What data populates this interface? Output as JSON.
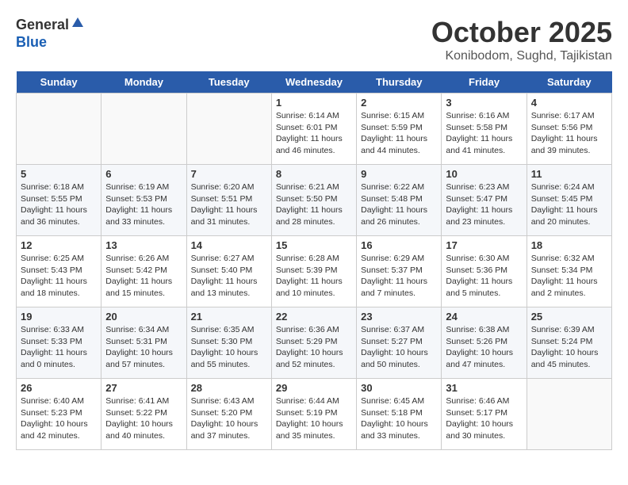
{
  "header": {
    "logo_general": "General",
    "logo_blue": "Blue",
    "title": "October 2025",
    "location": "Konibodom, Sughd, Tajikistan"
  },
  "days_of_week": [
    "Sunday",
    "Monday",
    "Tuesday",
    "Wednesday",
    "Thursday",
    "Friday",
    "Saturday"
  ],
  "weeks": [
    [
      {
        "day": "",
        "info": ""
      },
      {
        "day": "",
        "info": ""
      },
      {
        "day": "",
        "info": ""
      },
      {
        "day": "1",
        "info": "Sunrise: 6:14 AM\nSunset: 6:01 PM\nDaylight: 11 hours and 46 minutes."
      },
      {
        "day": "2",
        "info": "Sunrise: 6:15 AM\nSunset: 5:59 PM\nDaylight: 11 hours and 44 minutes."
      },
      {
        "day": "3",
        "info": "Sunrise: 6:16 AM\nSunset: 5:58 PM\nDaylight: 11 hours and 41 minutes."
      },
      {
        "day": "4",
        "info": "Sunrise: 6:17 AM\nSunset: 5:56 PM\nDaylight: 11 hours and 39 minutes."
      }
    ],
    [
      {
        "day": "5",
        "info": "Sunrise: 6:18 AM\nSunset: 5:55 PM\nDaylight: 11 hours and 36 minutes."
      },
      {
        "day": "6",
        "info": "Sunrise: 6:19 AM\nSunset: 5:53 PM\nDaylight: 11 hours and 33 minutes."
      },
      {
        "day": "7",
        "info": "Sunrise: 6:20 AM\nSunset: 5:51 PM\nDaylight: 11 hours and 31 minutes."
      },
      {
        "day": "8",
        "info": "Sunrise: 6:21 AM\nSunset: 5:50 PM\nDaylight: 11 hours and 28 minutes."
      },
      {
        "day": "9",
        "info": "Sunrise: 6:22 AM\nSunset: 5:48 PM\nDaylight: 11 hours and 26 minutes."
      },
      {
        "day": "10",
        "info": "Sunrise: 6:23 AM\nSunset: 5:47 PM\nDaylight: 11 hours and 23 minutes."
      },
      {
        "day": "11",
        "info": "Sunrise: 6:24 AM\nSunset: 5:45 PM\nDaylight: 11 hours and 20 minutes."
      }
    ],
    [
      {
        "day": "12",
        "info": "Sunrise: 6:25 AM\nSunset: 5:43 PM\nDaylight: 11 hours and 18 minutes."
      },
      {
        "day": "13",
        "info": "Sunrise: 6:26 AM\nSunset: 5:42 PM\nDaylight: 11 hours and 15 minutes."
      },
      {
        "day": "14",
        "info": "Sunrise: 6:27 AM\nSunset: 5:40 PM\nDaylight: 11 hours and 13 minutes."
      },
      {
        "day": "15",
        "info": "Sunrise: 6:28 AM\nSunset: 5:39 PM\nDaylight: 11 hours and 10 minutes."
      },
      {
        "day": "16",
        "info": "Sunrise: 6:29 AM\nSunset: 5:37 PM\nDaylight: 11 hours and 7 minutes."
      },
      {
        "day": "17",
        "info": "Sunrise: 6:30 AM\nSunset: 5:36 PM\nDaylight: 11 hours and 5 minutes."
      },
      {
        "day": "18",
        "info": "Sunrise: 6:32 AM\nSunset: 5:34 PM\nDaylight: 11 hours and 2 minutes."
      }
    ],
    [
      {
        "day": "19",
        "info": "Sunrise: 6:33 AM\nSunset: 5:33 PM\nDaylight: 11 hours and 0 minutes."
      },
      {
        "day": "20",
        "info": "Sunrise: 6:34 AM\nSunset: 5:31 PM\nDaylight: 10 hours and 57 minutes."
      },
      {
        "day": "21",
        "info": "Sunrise: 6:35 AM\nSunset: 5:30 PM\nDaylight: 10 hours and 55 minutes."
      },
      {
        "day": "22",
        "info": "Sunrise: 6:36 AM\nSunset: 5:29 PM\nDaylight: 10 hours and 52 minutes."
      },
      {
        "day": "23",
        "info": "Sunrise: 6:37 AM\nSunset: 5:27 PM\nDaylight: 10 hours and 50 minutes."
      },
      {
        "day": "24",
        "info": "Sunrise: 6:38 AM\nSunset: 5:26 PM\nDaylight: 10 hours and 47 minutes."
      },
      {
        "day": "25",
        "info": "Sunrise: 6:39 AM\nSunset: 5:24 PM\nDaylight: 10 hours and 45 minutes."
      }
    ],
    [
      {
        "day": "26",
        "info": "Sunrise: 6:40 AM\nSunset: 5:23 PM\nDaylight: 10 hours and 42 minutes."
      },
      {
        "day": "27",
        "info": "Sunrise: 6:41 AM\nSunset: 5:22 PM\nDaylight: 10 hours and 40 minutes."
      },
      {
        "day": "28",
        "info": "Sunrise: 6:43 AM\nSunset: 5:20 PM\nDaylight: 10 hours and 37 minutes."
      },
      {
        "day": "29",
        "info": "Sunrise: 6:44 AM\nSunset: 5:19 PM\nDaylight: 10 hours and 35 minutes."
      },
      {
        "day": "30",
        "info": "Sunrise: 6:45 AM\nSunset: 5:18 PM\nDaylight: 10 hours and 33 minutes."
      },
      {
        "day": "31",
        "info": "Sunrise: 6:46 AM\nSunset: 5:17 PM\nDaylight: 10 hours and 30 minutes."
      },
      {
        "day": "",
        "info": ""
      }
    ]
  ]
}
